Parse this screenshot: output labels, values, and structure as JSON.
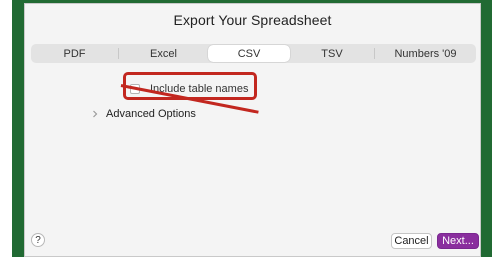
{
  "dialog": {
    "title": "Export Your Spreadsheet"
  },
  "tabs": [
    {
      "label": "PDF",
      "selected": false
    },
    {
      "label": "Excel",
      "selected": false
    },
    {
      "label": "CSV",
      "selected": true
    },
    {
      "label": "TSV",
      "selected": false
    },
    {
      "label": "Numbers '09",
      "selected": false
    }
  ],
  "options": {
    "include_table_names": {
      "label": "Include table names",
      "checked": false
    },
    "advanced_label": "Advanced Options"
  },
  "footer": {
    "help_label": "?",
    "cancel_label": "Cancel",
    "next_label": "Next..."
  },
  "colors": {
    "frame": "#216a33",
    "annotation": "#c2271f",
    "accent": "#8a2e9e"
  }
}
